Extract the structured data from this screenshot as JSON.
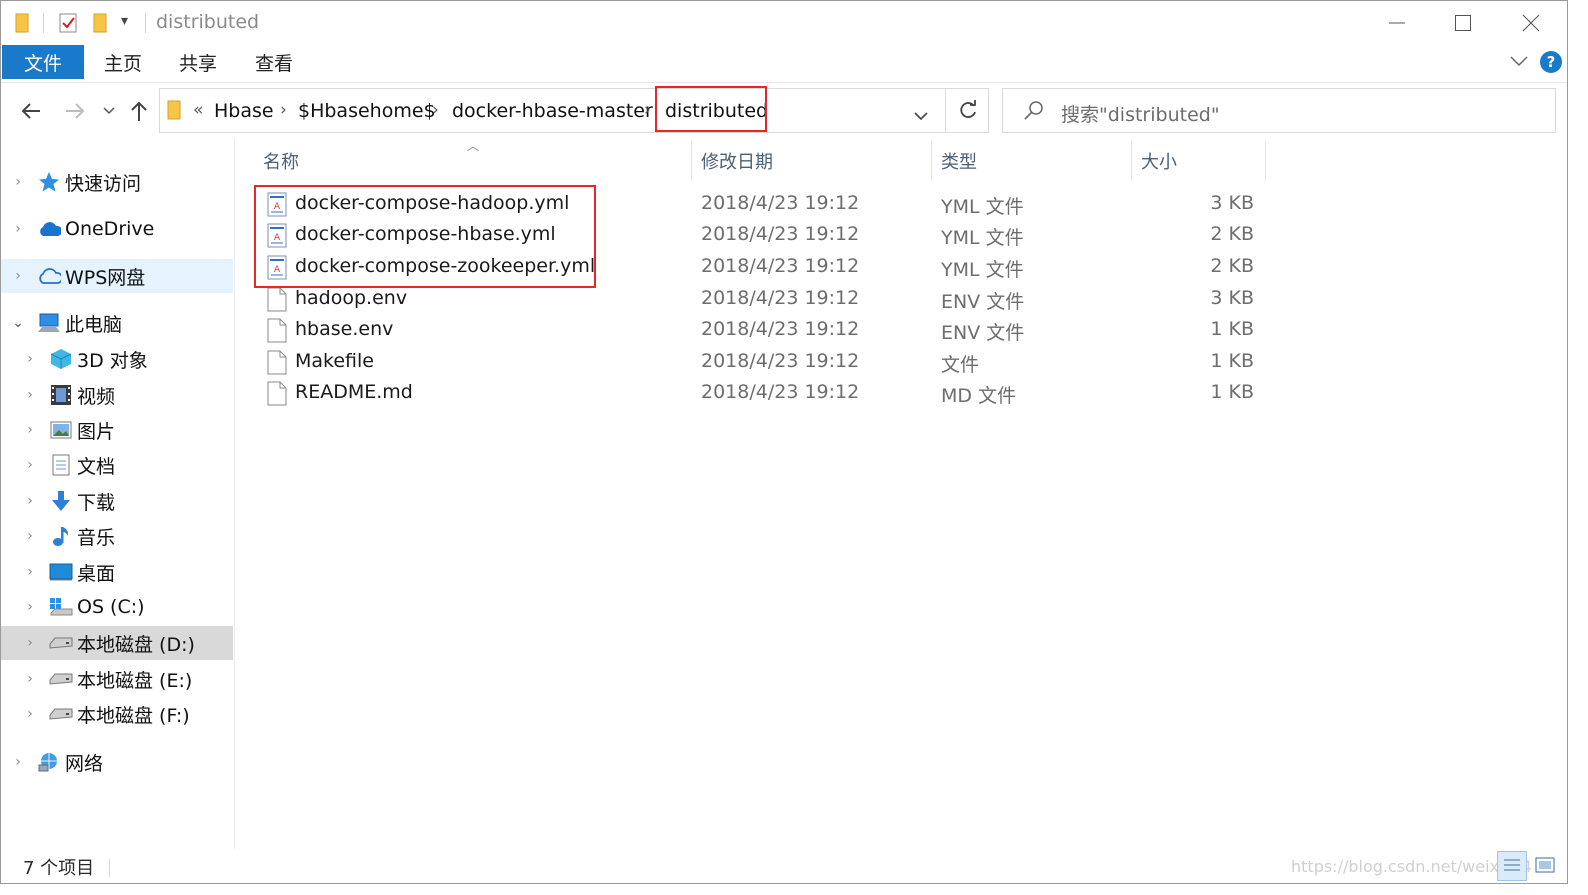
{
  "window": {
    "title": "distributed"
  },
  "ribbon": {
    "tabs": [
      {
        "label": "文件",
        "active": true
      },
      {
        "label": "主页"
      },
      {
        "label": "共享"
      },
      {
        "label": "查看"
      }
    ],
    "accent_color": "#1979ca"
  },
  "address": {
    "overflow_marker": "«",
    "crumbs": [
      "Hbase",
      "$Hbasehome$",
      "docker-hbase-master",
      "distributed"
    ],
    "refresh_icon": "refresh-icon",
    "search_placeholder": "搜索\"distributed\""
  },
  "nav": {
    "items": [
      {
        "label": "快速访问",
        "icon": "star-icon"
      },
      {
        "label": "OneDrive",
        "icon": "cloud-icon"
      },
      {
        "label": "WPS网盘",
        "icon": "wps-cloud-icon"
      },
      {
        "label": "此电脑",
        "icon": "computer-icon"
      },
      {
        "label": "3D 对象",
        "icon": "cube-icon"
      },
      {
        "label": "视频",
        "icon": "film-icon"
      },
      {
        "label": "图片",
        "icon": "picture-icon"
      },
      {
        "label": "文档",
        "icon": "document-icon"
      },
      {
        "label": "下载",
        "icon": "download-icon"
      },
      {
        "label": "音乐",
        "icon": "music-icon"
      },
      {
        "label": "桌面",
        "icon": "desktop-icon"
      },
      {
        "label": "OS (C:)",
        "icon": "windows-drive-icon"
      },
      {
        "label": "本地磁盘 (D:)",
        "icon": "drive-icon"
      },
      {
        "label": "本地磁盘 (E:)",
        "icon": "drive-icon"
      },
      {
        "label": "本地磁盘 (F:)",
        "icon": "drive-icon"
      },
      {
        "label": "网络",
        "icon": "network-icon"
      }
    ]
  },
  "files": {
    "columns": {
      "name": "名称",
      "modified": "修改日期",
      "type": "类型",
      "size": "大小"
    },
    "rows": [
      {
        "name": "docker-compose-hadoop.yml",
        "modified": "2018/4/23 19:12",
        "type": "YML 文件",
        "size": "3 KB",
        "icon": "yml-file-icon"
      },
      {
        "name": "docker-compose-hbase.yml",
        "modified": "2018/4/23 19:12",
        "type": "YML 文件",
        "size": "2 KB",
        "icon": "yml-file-icon"
      },
      {
        "name": "docker-compose-zookeeper.yml",
        "modified": "2018/4/23 19:12",
        "type": "YML 文件",
        "size": "2 KB",
        "icon": "yml-file-icon"
      },
      {
        "name": "hadoop.env",
        "modified": "2018/4/23 19:12",
        "type": "ENV 文件",
        "size": "3 KB",
        "icon": "blank-file-icon"
      },
      {
        "name": "hbase.env",
        "modified": "2018/4/23 19:12",
        "type": "ENV 文件",
        "size": "1 KB",
        "icon": "blank-file-icon"
      },
      {
        "name": "Makefile",
        "modified": "2018/4/23 19:12",
        "type": "文件",
        "size": "1 KB",
        "icon": "blank-file-icon"
      },
      {
        "name": "README.md",
        "modified": "2018/4/23 19:12",
        "type": "MD 文件",
        "size": "1 KB",
        "icon": "blank-file-icon"
      }
    ]
  },
  "status": {
    "item_count": "7 个项目"
  },
  "watermark": "https://blog.csdn.net/weixin_4"
}
